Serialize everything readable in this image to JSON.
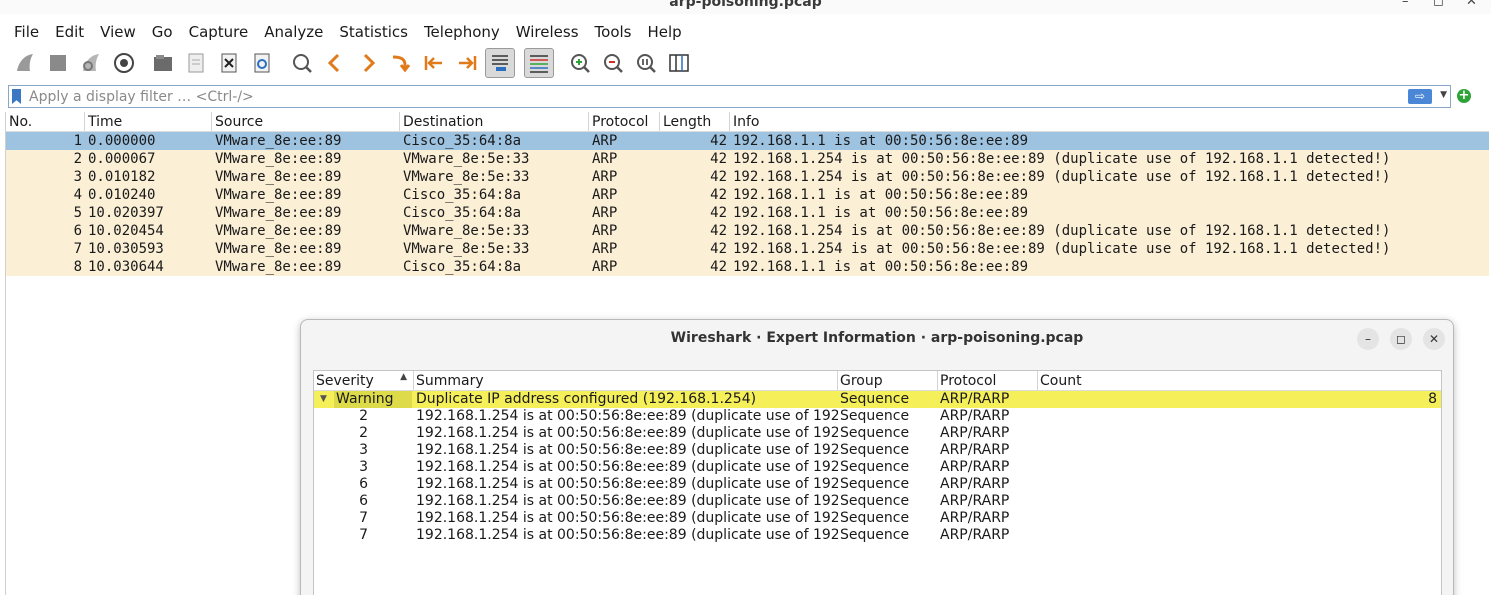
{
  "window": {
    "title": "arp-poisoning.pcap",
    "minimize": "–",
    "maximize": "◻",
    "close": "✕"
  },
  "menu": [
    "File",
    "Edit",
    "View",
    "Go",
    "Capture",
    "Analyze",
    "Statistics",
    "Telephony",
    "Wireless",
    "Tools",
    "Help"
  ],
  "filter": {
    "placeholder": "Apply a display filter … <Ctrl-/>"
  },
  "packet_list": {
    "columns": [
      "No.",
      "Time",
      "Source",
      "Destination",
      "Protocol",
      "Length",
      "Info"
    ],
    "rows": [
      {
        "no": "1",
        "time": "0.000000",
        "src": "VMware_8e:ee:89",
        "dst": "Cisco_35:64:8a",
        "proto": "ARP",
        "len": "42",
        "info": "192.168.1.1 is at 00:50:56:8e:ee:89"
      },
      {
        "no": "2",
        "time": "0.000067",
        "src": "VMware_8e:ee:89",
        "dst": "VMware_8e:5e:33",
        "proto": "ARP",
        "len": "42",
        "info": "192.168.1.254 is at 00:50:56:8e:ee:89 (duplicate use of 192.168.1.1 detected!)"
      },
      {
        "no": "3",
        "time": "0.010182",
        "src": "VMware_8e:ee:89",
        "dst": "VMware_8e:5e:33",
        "proto": "ARP",
        "len": "42",
        "info": "192.168.1.254 is at 00:50:56:8e:ee:89 (duplicate use of 192.168.1.1 detected!)"
      },
      {
        "no": "4",
        "time": "0.010240",
        "src": "VMware_8e:ee:89",
        "dst": "Cisco_35:64:8a",
        "proto": "ARP",
        "len": "42",
        "info": "192.168.1.1 is at 00:50:56:8e:ee:89"
      },
      {
        "no": "5",
        "time": "10.020397",
        "src": "VMware_8e:ee:89",
        "dst": "Cisco_35:64:8a",
        "proto": "ARP",
        "len": "42",
        "info": "192.168.1.1 is at 00:50:56:8e:ee:89"
      },
      {
        "no": "6",
        "time": "10.020454",
        "src": "VMware_8e:ee:89",
        "dst": "VMware_8e:5e:33",
        "proto": "ARP",
        "len": "42",
        "info": "192.168.1.254 is at 00:50:56:8e:ee:89 (duplicate use of 192.168.1.1 detected!)"
      },
      {
        "no": "7",
        "time": "10.030593",
        "src": "VMware_8e:ee:89",
        "dst": "VMware_8e:5e:33",
        "proto": "ARP",
        "len": "42",
        "info": "192.168.1.254 is at 00:50:56:8e:ee:89 (duplicate use of 192.168.1.1 detected!)"
      },
      {
        "no": "8",
        "time": "10.030644",
        "src": "VMware_8e:ee:89",
        "dst": "Cisco_35:64:8a",
        "proto": "ARP",
        "len": "42",
        "info": "192.168.1.1 is at 00:50:56:8e:ee:89"
      }
    ]
  },
  "expert": {
    "title": "Wireshark · Expert Information · arp-poisoning.pcap",
    "columns": [
      "Severity",
      "Summary",
      "Group",
      "Protocol",
      "Count"
    ],
    "group_row": {
      "severity": "Warning",
      "summary": "Duplicate IP address configured (192.168.1.254)",
      "group": "Sequence",
      "protocol": "ARP/RARP",
      "count": "8"
    },
    "child_rows": [
      {
        "packet": "2",
        "summary": "192.168.1.254 is at 00:50:56:8e:ee:89 (duplicate use of 192.…",
        "group": "Sequence",
        "protocol": "ARP/RARP"
      },
      {
        "packet": "2",
        "summary": "192.168.1.254 is at 00:50:56:8e:ee:89 (duplicate use of 192.…",
        "group": "Sequence",
        "protocol": "ARP/RARP"
      },
      {
        "packet": "3",
        "summary": "192.168.1.254 is at 00:50:56:8e:ee:89 (duplicate use of 192.…",
        "group": "Sequence",
        "protocol": "ARP/RARP"
      },
      {
        "packet": "3",
        "summary": "192.168.1.254 is at 00:50:56:8e:ee:89 (duplicate use of 192.…",
        "group": "Sequence",
        "protocol": "ARP/RARP"
      },
      {
        "packet": "6",
        "summary": "192.168.1.254 is at 00:50:56:8e:ee:89 (duplicate use of 192.…",
        "group": "Sequence",
        "protocol": "ARP/RARP"
      },
      {
        "packet": "6",
        "summary": "192.168.1.254 is at 00:50:56:8e:ee:89 (duplicate use of 192.…",
        "group": "Sequence",
        "protocol": "ARP/RARP"
      },
      {
        "packet": "7",
        "summary": "192.168.1.254 is at 00:50:56:8e:ee:89 (duplicate use of 192.…",
        "group": "Sequence",
        "protocol": "ARP/RARP"
      },
      {
        "packet": "7",
        "summary": "192.168.1.254 is at 00:50:56:8e:ee:89 (duplicate use of 192.…",
        "group": "Sequence",
        "protocol": "ARP/RARP"
      }
    ]
  },
  "colors": {
    "row_bg": "#fbefd6",
    "selected": "#9ec3e0",
    "warning": "#f5f05a"
  }
}
